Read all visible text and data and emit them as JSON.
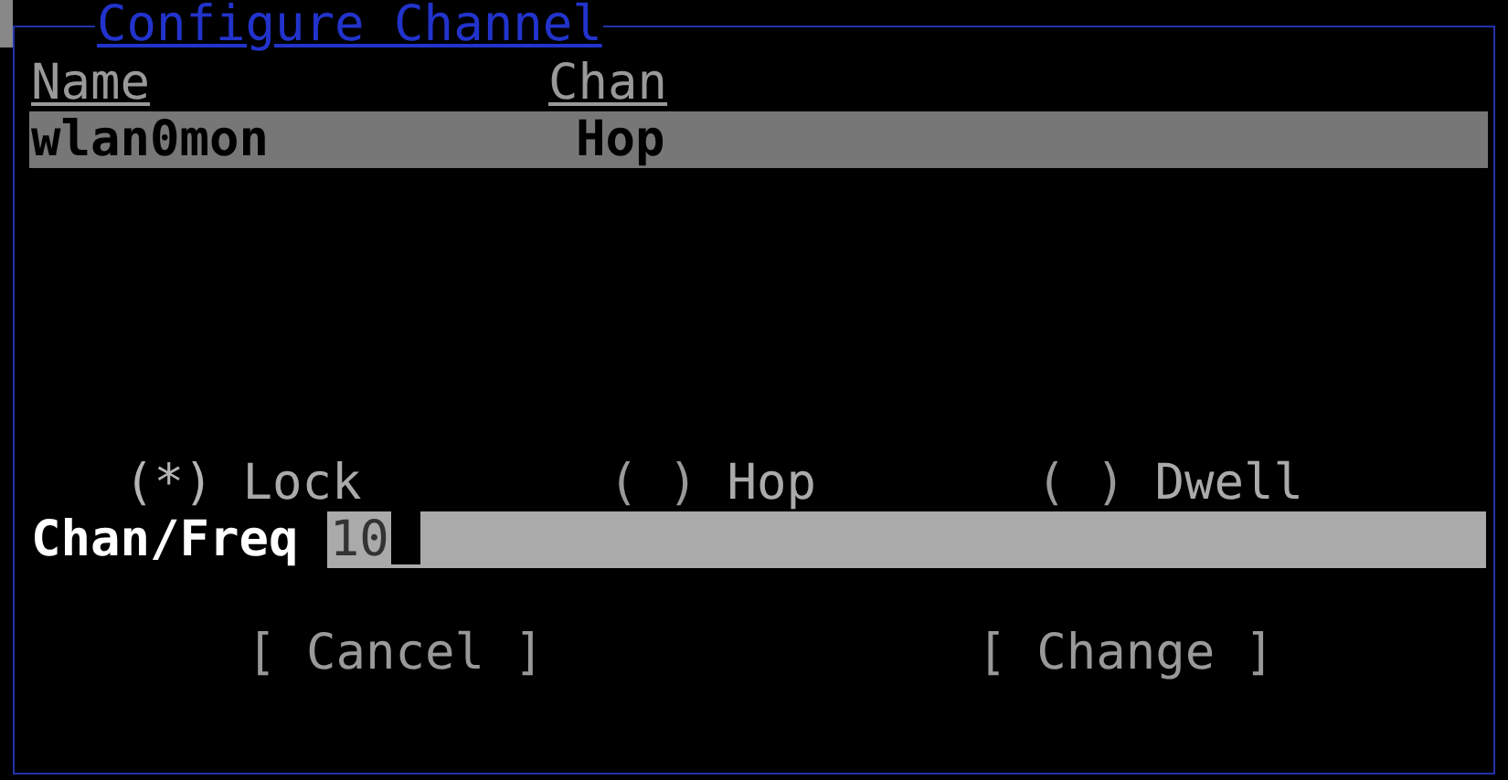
{
  "dialog": {
    "title": "Configure Channel"
  },
  "table": {
    "columns": [
      "Name",
      "Chan"
    ],
    "rows": [
      {
        "cells": [
          "wlan0mon",
          "Hop"
        ],
        "selected": true
      }
    ]
  },
  "mode": {
    "on_mark": "(*)",
    "off_mark": "( )",
    "options": [
      {
        "label": "Lock",
        "selected": true
      },
      {
        "label": "Hop",
        "selected": false
      },
      {
        "label": "Dwell",
        "selected": false
      }
    ]
  },
  "field": {
    "label": "Chan/Freq",
    "value": "10"
  },
  "buttons": [
    "[ Cancel ]",
    "[ Change ]"
  ]
}
